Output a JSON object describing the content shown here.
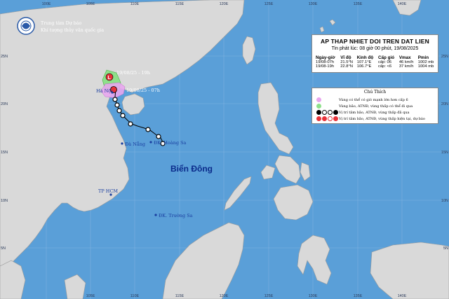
{
  "agency": {
    "line1": "Trung tâm Dự báo",
    "line2": "Khí tượng thủy văn quốc gia"
  },
  "bulletin": {
    "title": "AP THAP NHIET DOI TREN DAT LIEN",
    "issued": "Tin phát lúc: 08 giờ 00 phút, 19/08/2025",
    "headers": [
      "Ngày-giờ",
      "Vĩ độ",
      "Kinh độ",
      "Cấp gió",
      "Vmax",
      "Pmin"
    ],
    "rows": [
      [
        "19/08-07h",
        "21.5°N",
        "107.1°E",
        "cấp: 06",
        "46 km/h",
        "1002 mb"
      ],
      [
        "19/08-19h",
        "22.8°N",
        "106.7°E",
        "cấp: <6",
        "37 km/h",
        "1004 mb"
      ]
    ]
  },
  "legend": {
    "title": "Chú Thích",
    "items": [
      "Vùng có thể có gió mạnh lớn hơn cấp 6",
      "Vùng bão, ATNĐ, vùng thấp có thể đi qua",
      "Vị trí tâm bão, ATNĐ, vùng thấp đã qua",
      "Vị trí tâm bão, ATNĐ, vùng thấp hiện tại, dự báo"
    ],
    "colors": {
      "strong_wind": "#e8a6ee",
      "path_area": "#8ee08a",
      "past": "#000000",
      "current": "#e8333a"
    }
  },
  "labels": {
    "sea": "Biển Đông",
    "hanoi": "Hà Nội",
    "danang": "Đà Nẵng",
    "hoangsa": "ĐK. Hoàng Sa",
    "hcm": "TP HCM",
    "truongsa": "ĐK. Trường Sa",
    "forecast_time": "19/08/25 - 19h",
    "current_time": "19/08/25 - 07h",
    "forecast_symbol": "L"
  },
  "grid": {
    "top_lon": [
      "100E",
      "105E",
      "110E",
      "115E",
      "120E",
      "125E",
      "130E",
      "135E",
      "140E"
    ],
    "bottom_lon": [
      "105E",
      "110E",
      "115E",
      "120E",
      "125E",
      "130E",
      "135E",
      "140E"
    ],
    "left_lat": [
      "25N",
      "20N",
      "15N",
      "10N",
      "5N"
    ],
    "right_lat": [
      "25N",
      "20N",
      "15N",
      "10N",
      "5N"
    ]
  }
}
